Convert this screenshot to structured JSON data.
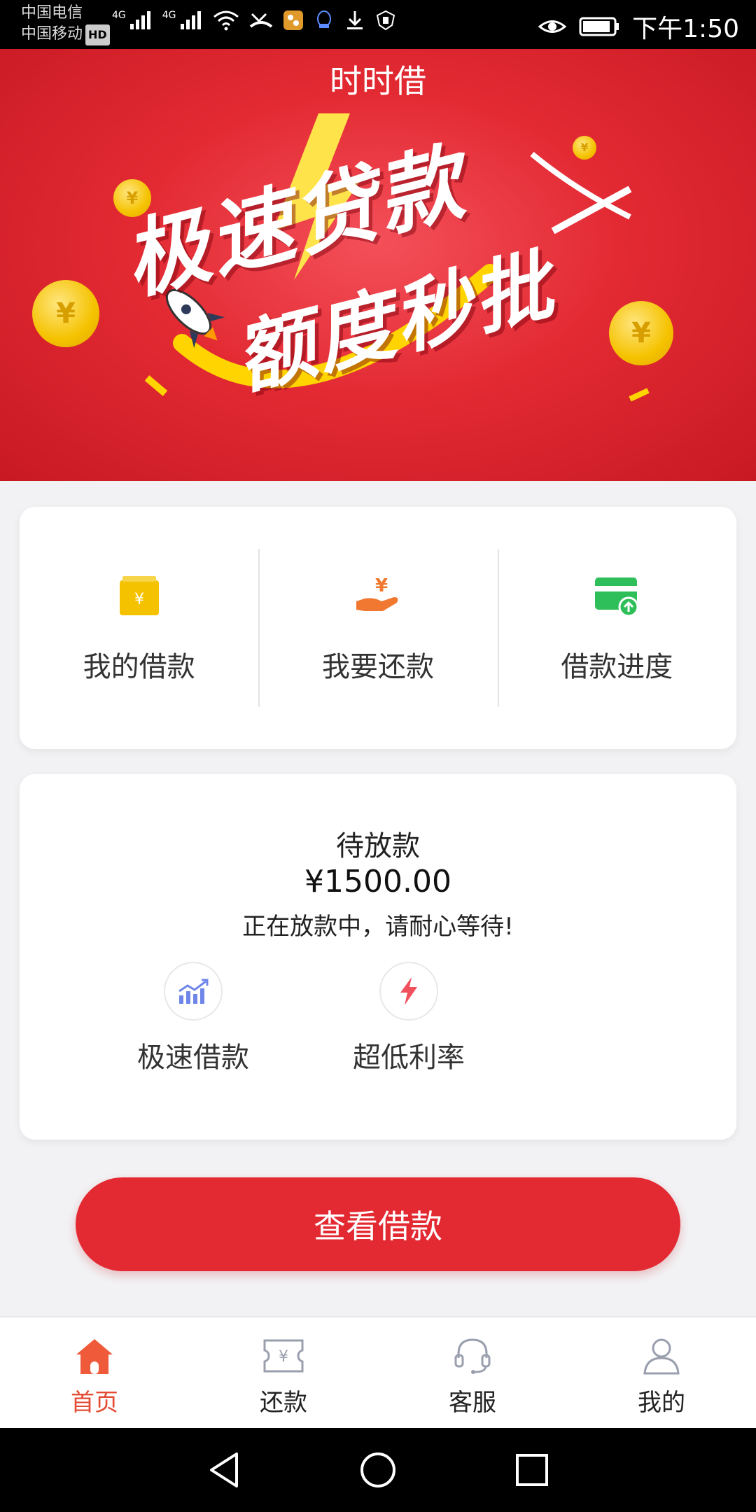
{
  "status_bar": {
    "carrier_1": "中国电信",
    "carrier_2": "中国移动",
    "hd": "HD",
    "sig1": "4G",
    "sig2": "4G",
    "time": "下午1:50"
  },
  "banner": {
    "title": "时时借",
    "slogan_line1": "极速贷款",
    "slogan_line2": "额度秒批",
    "coin_symbol": "¥"
  },
  "quick_actions": [
    {
      "label": "我的借款",
      "icon": "wallet-icon"
    },
    {
      "label": "我要还款",
      "icon": "repay-hand-icon"
    },
    {
      "label": "借款进度",
      "icon": "card-progress-icon"
    }
  ],
  "status_card": {
    "title": "待放款",
    "amount": "¥1500.00",
    "note": "正在放款中，请耐心等待!",
    "features": [
      {
        "label": "极速借款",
        "icon": "trend-chart-icon"
      },
      {
        "label": "超低利率",
        "icon": "lightning-icon"
      }
    ]
  },
  "cta": {
    "label": "查看借款"
  },
  "tabbar": {
    "items": [
      {
        "label": "首页",
        "icon": "home-icon",
        "active": true
      },
      {
        "label": "还款",
        "icon": "ticket-icon",
        "active": false
      },
      {
        "label": "客服",
        "icon": "headset-icon",
        "active": false
      },
      {
        "label": "我的",
        "icon": "user-icon",
        "active": false
      }
    ]
  },
  "colors": {
    "brand_red": "#e32a33",
    "active_tab": "#e34b33",
    "wallet_yellow": "#f5c200",
    "repay_orange": "#f07830",
    "progress_green": "#2fbf5a"
  }
}
